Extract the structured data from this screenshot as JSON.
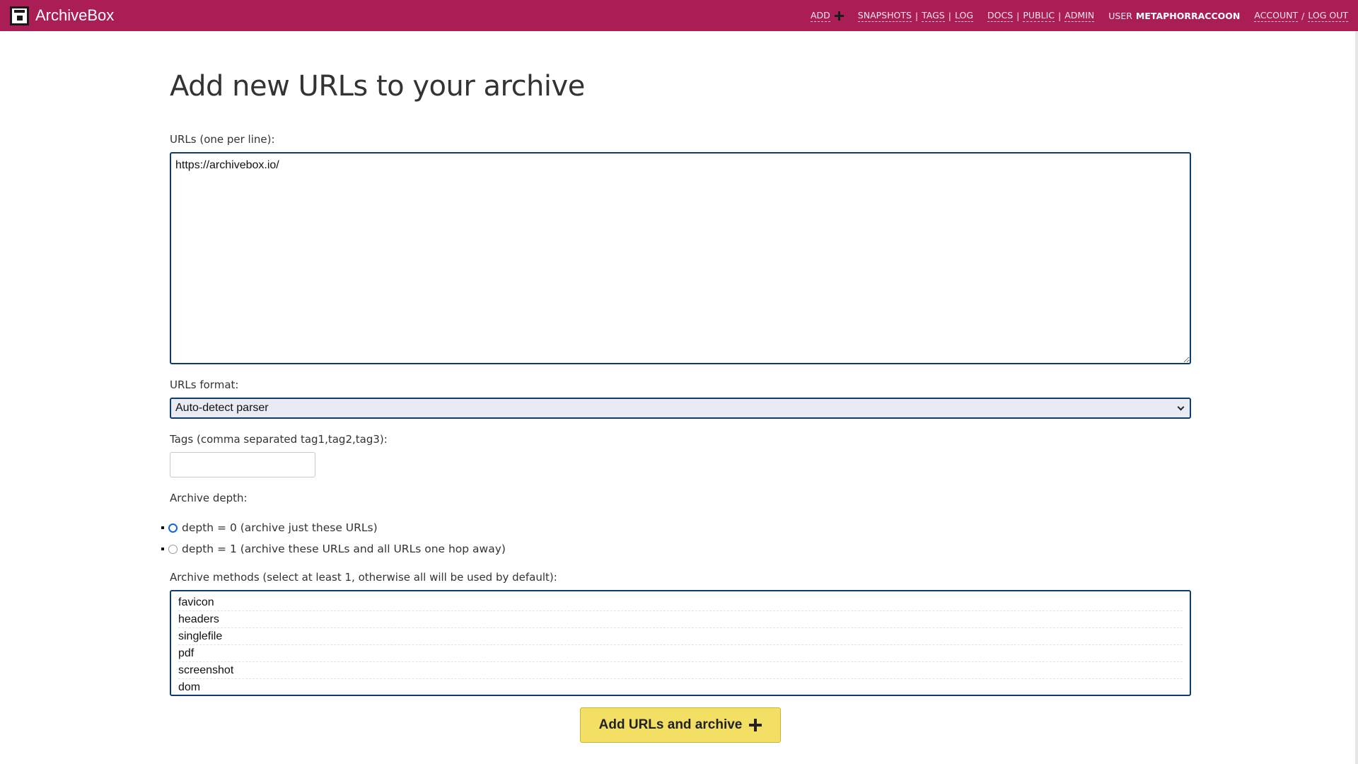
{
  "header": {
    "brand": "ArchiveBox",
    "nav": {
      "add": "ADD",
      "snapshots": "SNAPSHOTS",
      "tags": "TAGS",
      "log": "LOG",
      "docs": "DOCS",
      "public": "PUBLIC",
      "admin": "ADMIN",
      "user_label": "USER",
      "user_name": "METAPHORRACCOON",
      "account": "ACCOUNT",
      "logout": "LOG OUT",
      "pipe": "|",
      "slash": "/"
    },
    "colors": {
      "background": "#aa1e55"
    }
  },
  "page": {
    "title": "Add new URLs to your archive"
  },
  "form": {
    "urls_label": "URLs (one per line):",
    "urls_value": "https://archivebox.io/",
    "format_label": "URLs format:",
    "format_selected": "Auto-detect parser",
    "tags_label": "Tags (comma separated tag1,tag2,tag3):",
    "tags_value": "",
    "depth_label": "Archive depth:",
    "depth_options": [
      {
        "label": "depth = 0 (archive just these URLs)",
        "checked": true
      },
      {
        "label": "depth = 1 (archive these URLs and all URLs one hop away)",
        "checked": false
      }
    ],
    "methods_label": "Archive methods (select at least 1, otherwise all will be used by default):",
    "methods": [
      "favicon",
      "headers",
      "singlefile",
      "pdf",
      "screenshot",
      "dom"
    ],
    "submit_label": "Add URLs and archive",
    "submit_color": "#f3df63"
  }
}
